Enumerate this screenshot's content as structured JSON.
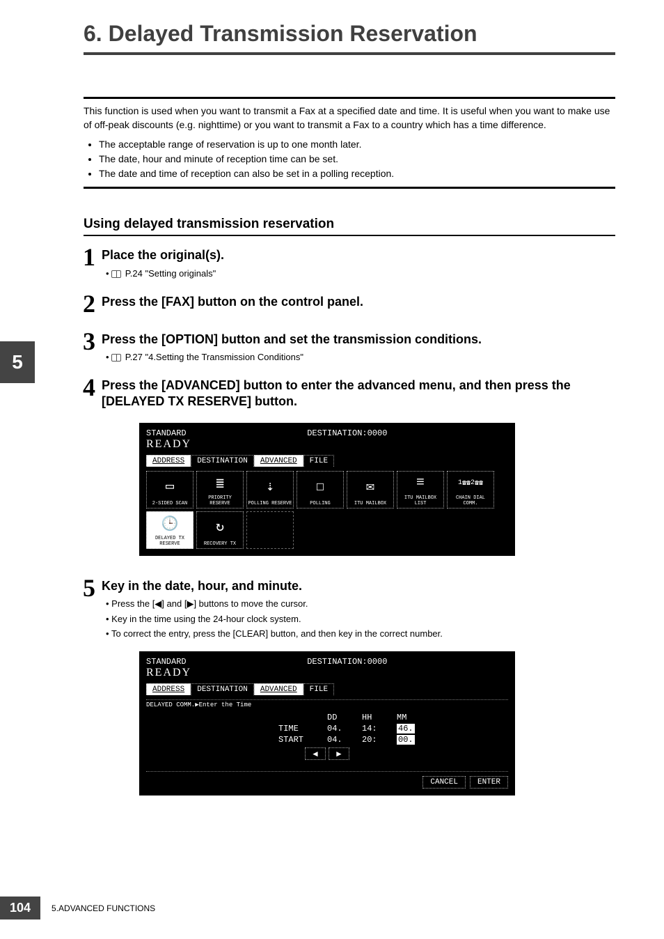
{
  "chapter": {
    "number": "6.",
    "title": "Delayed Transmission Reservation"
  },
  "intro": "This function is used when you want to transmit a Fax at a specified date and time. It is useful when you want to make use of off-peak discounts (e.g. nighttime) or you want to transmit a Fax to a country which has a time difference.",
  "intro_bullets": [
    "The acceptable range of reservation is up to one month later.",
    "The date, hour and minute of reception time can be set.",
    "The date and time of reception can also be set in a polling reception."
  ],
  "section_title": "Using delayed transmission reservation",
  "side_tab": "5",
  "steps": {
    "s1": {
      "num": "1",
      "head": "Place the original(s).",
      "ref": "P.24 \"Setting originals\""
    },
    "s2": {
      "num": "2",
      "head": "Press the [FAX] button on the control panel."
    },
    "s3": {
      "num": "3",
      "head": "Press the [OPTION] button and set the transmission conditions.",
      "ref": "P.27 \"4.Setting the Transmission Conditions\""
    },
    "s4": {
      "num": "4",
      "head": "Press the [ADVANCED] button to enter the advanced menu, and then press the [DELAYED TX RESERVE] button."
    },
    "s5": {
      "num": "5",
      "head": "Key in the date, hour, and minute.",
      "subs": [
        "Press the [◀] and [▶] buttons to move the cursor.",
        "Key in the time using the 24-hour clock system.",
        "To correct the entry, press the [CLEAR] button, and then key in the correct number."
      ]
    }
  },
  "lcd_common": {
    "standard": "STANDARD",
    "destination": "DESTINATION:0000",
    "ready": "READY",
    "tabs": [
      "ADDRESS",
      "DESTINATION",
      "ADVANCED",
      "FILE"
    ]
  },
  "lcd1": {
    "row1": [
      "2-SIDED SCAN",
      "PRIORITY RESERVE",
      "POLLING RESERVE",
      "POLLING",
      "ITU MAILBOX",
      "ITU MAILBOX LIST",
      "CHAIN DIAL COMM."
    ],
    "row2": [
      "DELAYED TX RESERVE",
      "RECOVERY TX",
      ""
    ],
    "chain_top": "1",
    "chain_bot": "2"
  },
  "lcd2": {
    "prompt": "DELAYED COMM.▶Enter the Time",
    "headers": {
      "dd": "DD",
      "hh": "HH",
      "mm": "MM"
    },
    "time_label": "TIME",
    "start_label": "START",
    "time": {
      "dd": "04.",
      "hh": "14:",
      "mm": "46."
    },
    "start": {
      "dd": "04.",
      "hh": "20:",
      "mm": "00."
    },
    "arrows": {
      "left": "◄",
      "right": "►"
    },
    "cancel": "CANCEL",
    "enter": "ENTER"
  },
  "footer": {
    "page": "104",
    "text": "5.ADVANCED FUNCTIONS"
  }
}
